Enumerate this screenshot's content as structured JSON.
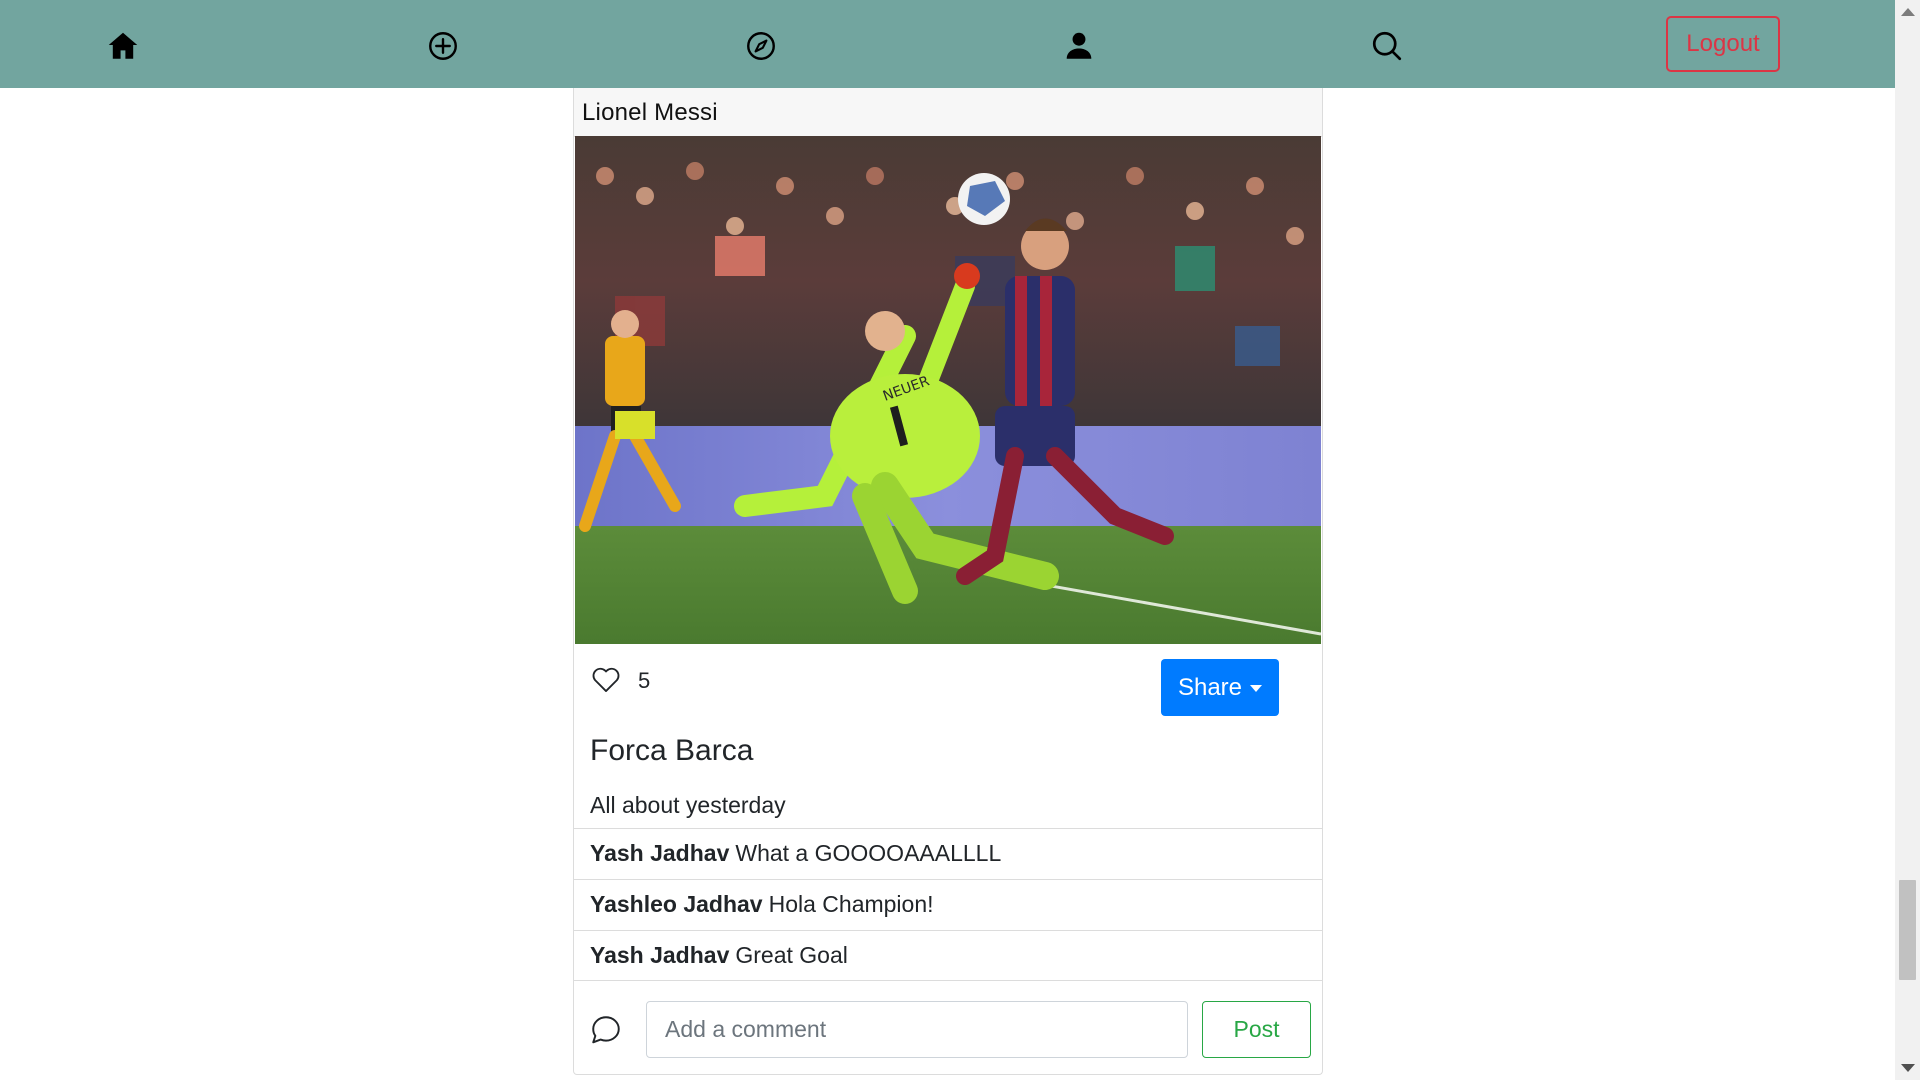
{
  "navbar": {
    "background": "#72a59f",
    "icons": [
      "home-icon",
      "add-circle-icon",
      "compass-icon",
      "profile-icon",
      "search-icon"
    ],
    "logout_label": "Logout",
    "logout_color": "#dc3545"
  },
  "post": {
    "author": "Lionel Messi",
    "image_icon": "football-photo",
    "likes": "5",
    "like_icon": "heart-outline-icon",
    "share_label": "Share",
    "share_color": "#007bff",
    "title": "Forca Barca",
    "caption": "All about yesterday",
    "comments": [
      {
        "author": "Yash Jadhav",
        "text": "What a GOOOOAAALLLL"
      },
      {
        "author": "Yashleo Jadhav",
        "text": "Hola Champion!"
      },
      {
        "author": "Yash Jadhav",
        "text": "Great Goal"
      }
    ],
    "comment_icon": "chat-bubble-icon",
    "comment_placeholder": "Add a comment",
    "post_label": "Post",
    "post_color": "#28a745"
  }
}
